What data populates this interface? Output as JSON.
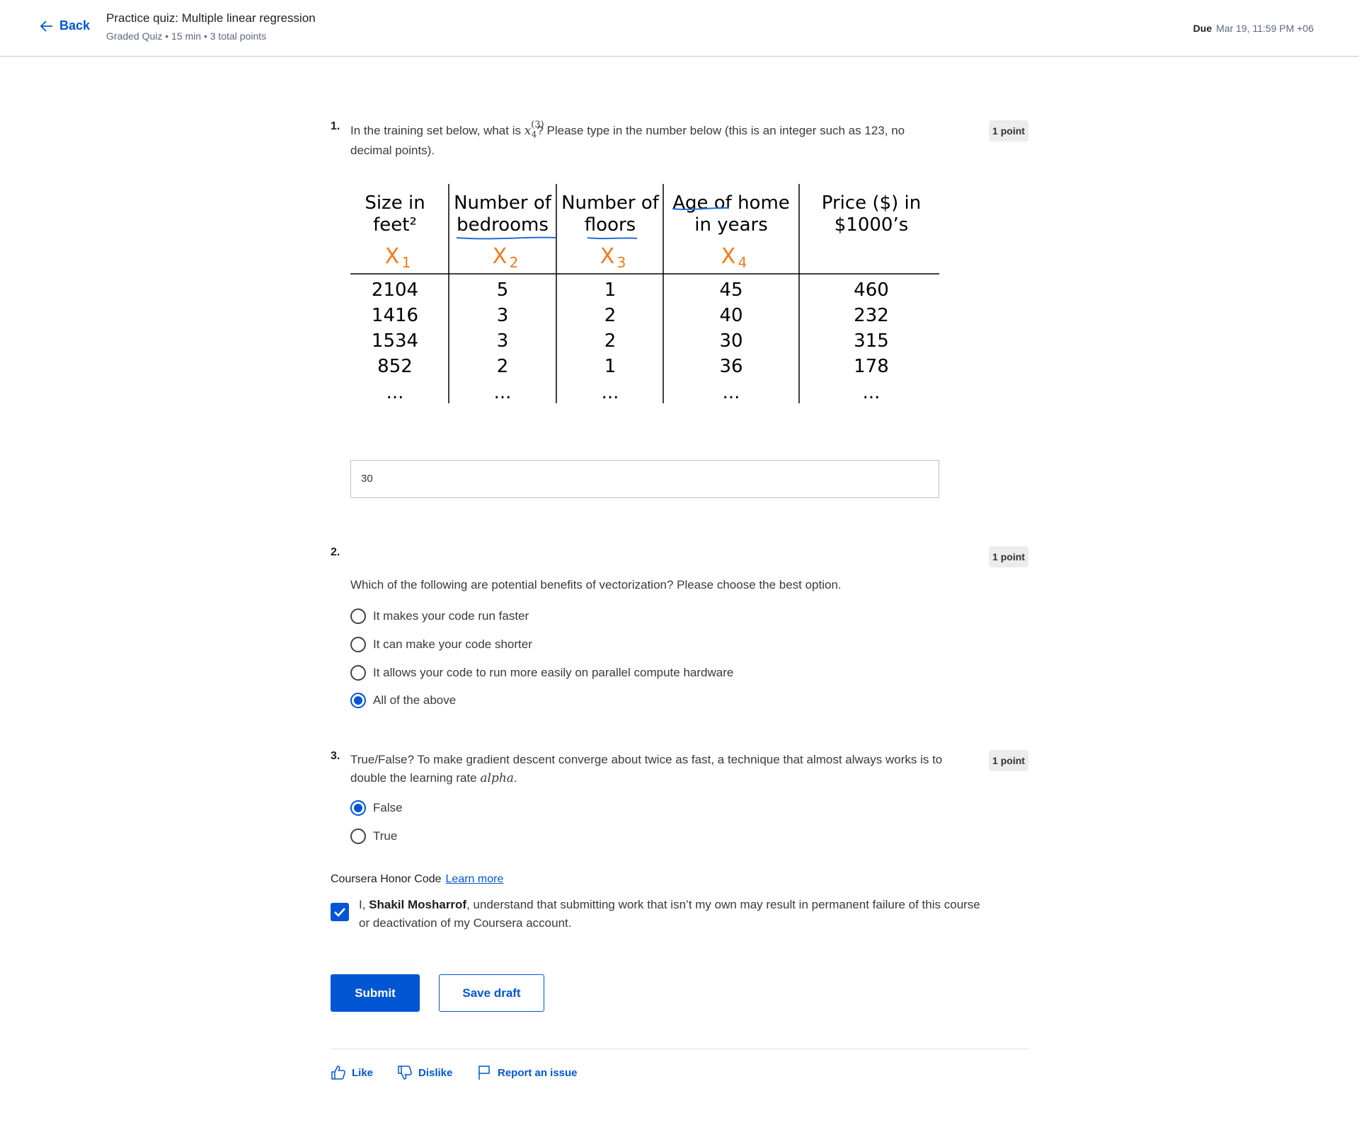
{
  "header": {
    "back_label": "Back",
    "title": "Practice quiz: Multiple linear regression",
    "meta": "Graded Quiz • 15 min • 3 total points",
    "due_label": "Due",
    "due_value": "Mar 19, 11:59 PM +06"
  },
  "q1": {
    "number": "1.",
    "text_before": "In the training set below, what is ",
    "math_var": "x",
    "math_sup": "(3)",
    "math_sub": "4",
    "text_after": "? Please type in the number below (this is an integer such as 123, no decimal points).",
    "points": "1 point",
    "table": {
      "headers": [
        [
          "Size in",
          "feet²"
        ],
        [
          "Number of",
          "bedrooms"
        ],
        [
          "Number of",
          "floors"
        ],
        [
          "Age of home",
          "in years"
        ],
        [
          "Price ($) in",
          "$1000’s"
        ]
      ],
      "features": [
        "X1",
        "X2",
        "X3",
        "X4",
        ""
      ],
      "rows": [
        [
          "2104",
          "5",
          "1",
          "45",
          "460"
        ],
        [
          "1416",
          "3",
          "2",
          "40",
          "232"
        ],
        [
          "1534",
          "3",
          "2",
          "30",
          "315"
        ],
        [
          "852",
          "2",
          "1",
          "36",
          "178"
        ],
        [
          "...",
          "...",
          "...",
          "...",
          "..."
        ]
      ]
    },
    "answer": "30"
  },
  "q2": {
    "number": "2.",
    "points": "1 point",
    "text": "Which of the following are potential benefits of vectorization? Please choose the best option.",
    "options": [
      "It makes your code run faster",
      "It can make your code shorter",
      "It allows your code to run more easily on parallel compute hardware",
      "All of the above"
    ],
    "selected_index": 3
  },
  "q3": {
    "number": "3.",
    "points": "1 point",
    "text": "True/False? To make gradient descent converge about twice as fast, a technique that almost always works is to double the learning rate",
    "math": "alpha",
    "end": ".",
    "options": [
      "False",
      "True"
    ],
    "selected_index": 0
  },
  "honor": {
    "title": "Coursera Honor Code",
    "learn_more": "Learn more",
    "prefix": "I, ",
    "name": "Shakil Mosharrof",
    "text": ", understand that submitting work that isn’t my own may result in permanent failure of this course or deactivation of my Coursera account.",
    "checked": true
  },
  "actions": {
    "submit": "Submit",
    "save_draft": "Save draft"
  },
  "footer": {
    "like": "Like",
    "dislike": "Dislike",
    "report": "Report an issue"
  },
  "colors": {
    "accent": "#0056d2",
    "handwriting_orange": "#f07c1e",
    "handwriting_blue": "#1f6fd6"
  }
}
